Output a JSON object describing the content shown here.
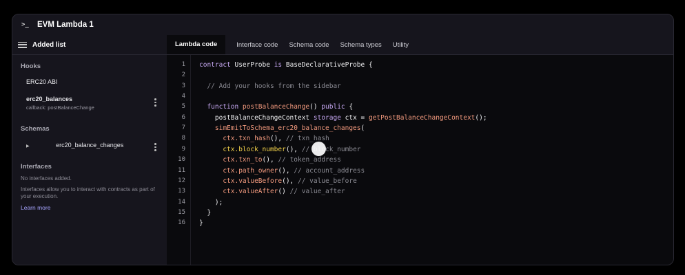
{
  "window": {
    "title": "EVM Lambda 1",
    "icon": "terminal-icon",
    "icon_glyph": ">_"
  },
  "sidebar": {
    "header": "Added list",
    "hooks_label": "Hooks",
    "hooks": [
      {
        "label": "ERC20 ABI"
      },
      {
        "label": "erc20_balances",
        "sub": "callback: postBalanceChange"
      }
    ],
    "schemas_label": "Schemas",
    "schemas": [
      {
        "label": "erc20_balance_changes"
      }
    ],
    "interfaces_label": "Interfaces",
    "interfaces_empty": "No interfaces added.",
    "interfaces_help": "Interfaces allow you to interact with contracts as part of your execution.",
    "learn_more": "Learn more"
  },
  "tabs": [
    {
      "label": "Lambda code",
      "active": true
    },
    {
      "label": "Interface code"
    },
    {
      "label": "Schema code"
    },
    {
      "label": "Schema types"
    },
    {
      "label": "Utility"
    }
  ],
  "colors": {
    "keyword": "#c6a8f2",
    "function": "#f39a7e",
    "comment": "#8b8b93",
    "highlight": "#f4d34a",
    "link": "#a7a5ff"
  },
  "code": [
    [
      [
        "kw",
        "contract"
      ],
      [
        "tx",
        " UserProbe "
      ],
      [
        "kw",
        "is"
      ],
      [
        "tx",
        " BaseDeclarativeProbe {"
      ]
    ],
    [],
    [
      [
        "cm",
        "  // Add your hooks from the sidebar"
      ]
    ],
    [],
    [
      [
        "kw",
        "  function "
      ],
      [
        "fn",
        "postBalanceChange"
      ],
      [
        "tx",
        "() "
      ],
      [
        "kw",
        "public"
      ],
      [
        "tx",
        " {"
      ]
    ],
    [
      [
        "tx",
        "    postBalanceChangeContext "
      ],
      [
        "kw",
        "storage"
      ],
      [
        "tx",
        " ctx = "
      ],
      [
        "fn",
        "getPostBalanceChangeContext"
      ],
      [
        "tx",
        "();"
      ]
    ],
    [
      [
        "fn",
        "    simEmitToSchema_erc20_balance_changes"
      ],
      [
        "tx",
        "("
      ]
    ],
    [
      [
        "fn",
        "      ctx.txn_hash"
      ],
      [
        "tx",
        "(), "
      ],
      [
        "cm",
        "// txn_hash"
      ]
    ],
    [
      [
        "hl",
        "      ctx.block_number"
      ],
      [
        "tx",
        "(), "
      ],
      [
        "cm",
        "// block_number"
      ]
    ],
    [
      [
        "fn",
        "      ctx.txn_to"
      ],
      [
        "tx",
        "(), "
      ],
      [
        "cm",
        "// token_address"
      ]
    ],
    [
      [
        "fn",
        "      ctx.path_owner"
      ],
      [
        "tx",
        "(), "
      ],
      [
        "cm",
        "// account_address"
      ]
    ],
    [
      [
        "fn",
        "      ctx.valueBefore"
      ],
      [
        "tx",
        "(), "
      ],
      [
        "cm",
        "// value_before"
      ]
    ],
    [
      [
        "fn",
        "      ctx.valueAfter"
      ],
      [
        "tx",
        "() "
      ],
      [
        "cm",
        "// value_after"
      ]
    ],
    [
      [
        "tx",
        "    );"
      ]
    ],
    [
      [
        "tx",
        "  }"
      ]
    ],
    [
      [
        "tx",
        "}"
      ]
    ]
  ]
}
